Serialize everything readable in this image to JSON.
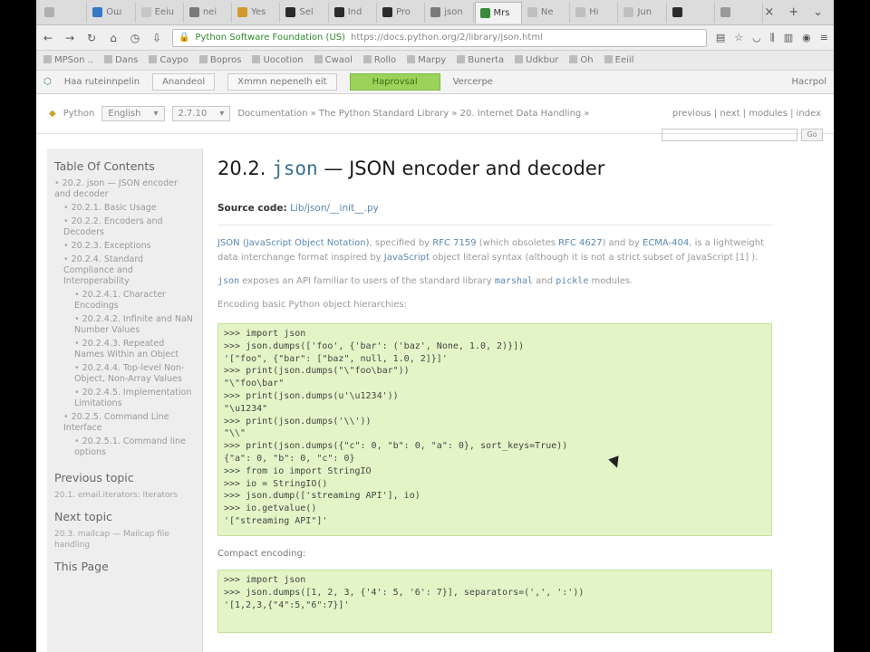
{
  "browser": {
    "tabs": [
      {
        "label": "",
        "color": "#b0b0b0"
      },
      {
        "label": "Ош",
        "color": "#3478c6"
      },
      {
        "label": "Eeiu",
        "color": "#c6c6c6"
      },
      {
        "label": "nei",
        "color": "#7a7a7a"
      },
      {
        "label": "Yes",
        "color": "#d29a2a"
      },
      {
        "label": "Sel",
        "color": "#2b2b2b"
      },
      {
        "label": "Ind",
        "color": "#2b2b2b"
      },
      {
        "label": "Pro",
        "color": "#2b2b2b"
      },
      {
        "label": "json",
        "color": "#7a7a7a"
      },
      {
        "label": "Mrs",
        "color": "#3a8a3a"
      },
      {
        "label": "Ne",
        "color": "#bfbfbf"
      },
      {
        "label": "Hi",
        "color": "#bfbfbf"
      },
      {
        "label": "Jun",
        "color": "#bfbfbf"
      },
      {
        "label": "",
        "color": "#2b2b2b"
      },
      {
        "label": "",
        "color": "#9a9a9a"
      }
    ],
    "tab_controls": {
      "close": "×",
      "new_tab": "+",
      "menu": "⌄"
    },
    "url": {
      "site_identity": "Python Software Foundation (US)",
      "address": "https://docs.python.org/2/library/json.html"
    },
    "bookmarks": [
      "MPSon ..",
      "Dans",
      "Сауро",
      "Bopros",
      "Uocotion",
      "Cwaol",
      "Rollo",
      "Marpy",
      "Bunerta",
      "Udkbur",
      "Oh",
      "Eeiil"
    ],
    "translate_bar": {
      "text1": "Haa ruteinnpelin",
      "text2": "Anandeol",
      "text3": "Xmmn nepenelh eit",
      "button": "Haprovsal",
      "text4": "Vercerpe",
      "right": "Hacrpol"
    }
  },
  "page": {
    "related": {
      "python": "Python",
      "language": "English",
      "version": "2.7.10",
      "breadcrumb": "Documentation » The Python Standard Library » 20. Internet Data Handling »",
      "links": "previous | next | modules | index"
    },
    "sidebar": {
      "toc_title": "Table Of Contents",
      "toc": [
        {
          "level": 1,
          "text": "20.2. json — JSON encoder and decoder"
        },
        {
          "level": 2,
          "text": "20.2.1. Basic Usage"
        },
        {
          "level": 2,
          "text": "20.2.2. Encoders and Decoders"
        },
        {
          "level": 2,
          "text": "20.2.3. Exceptions"
        },
        {
          "level": 2,
          "text": "20.2.4. Standard Compliance and Interoperability"
        },
        {
          "level": 3,
          "text": "20.2.4.1. Character Encodings"
        },
        {
          "level": 3,
          "text": "20.2.4.2. Infinite and NaN Number Values"
        },
        {
          "level": 3,
          "text": "20.2.4.3. Repeated Names Within an Object"
        },
        {
          "level": 3,
          "text": "20.2.4.4. Top-level Non-Object, Non-Array Values"
        },
        {
          "level": 3,
          "text": "20.2.4.5. Implementation Limitations"
        },
        {
          "level": 2,
          "text": "20.2.5. Command Line Interface"
        },
        {
          "level": 3,
          "text": "20.2.5.1. Command line options"
        }
      ],
      "previous_title": "Previous topic",
      "previous_link": "20.1. email.iterators: Iterators",
      "next_title": "Next topic",
      "next_link": "20.3. mailcap — Mailcap file handling",
      "this_page_title": "This Page"
    },
    "content": {
      "title_prefix": "20.2.",
      "title_module": "json",
      "title_rest": "— JSON encoder and decoder",
      "source_label": "Source code:",
      "source_link": "Lib/json/__init__.py",
      "para1_a": "JSON (JavaScript Object Notation)",
      "para1_b": ", specified by ",
      "para1_c": "RFC 7159",
      "para1_d": " (which obsoletes ",
      "para1_e": "RFC 4627",
      "para1_f": ") and by ",
      "para1_g": "ECMA-404",
      "para1_h": ", is a lightweight data interchange format inspired by ",
      "para1_i": "JavaScript",
      "para1_j": " object literal syntax (although it is not a strict subset of JavaScript [1] ).",
      "para2_a": "json",
      "para2_b": " exposes an API familiar to users of the standard library ",
      "para2_c": "marshal",
      "para2_d": " and ",
      "para2_e": "pickle",
      "para2_f": " modules.",
      "para3": "Encoding basic Python object hierarchies:",
      "code1": [
        ">>> import json",
        ">>> json.dumps(['foo', {'bar': ('baz', None, 1.0, 2)}])",
        "'[\"foo\", {\"bar\": [\"baz\", null, 1.0, 2]}]'",
        ">>> print(json.dumps(\"\\\"foo\\bar\"))",
        "\"\\\"foo\\bar\"",
        ">>> print(json.dumps(u'\\u1234'))",
        "\"\\u1234\"",
        ">>> print(json.dumps('\\\\'))",
        "\"\\\\\"",
        ">>> print(json.dumps({\"c\": 0, \"b\": 0, \"a\": 0}, sort_keys=True))",
        "{\"a\": 0, \"b\": 0, \"c\": 0}",
        ">>> from io import StringIO",
        ">>> io = StringIO()",
        ">>> json.dump(['streaming API'], io)",
        ">>> io.getvalue()",
        "'[\"streaming API\"]'"
      ],
      "label2": "Compact encoding:",
      "code2": [
        ">>> import json",
        ">>> json.dumps([1, 2, 3, {'4': 5, '6': 7}], separators=(',', ':'))",
        "'[1,2,3,{\"4\":5,\"6\":7}]'"
      ]
    }
  }
}
